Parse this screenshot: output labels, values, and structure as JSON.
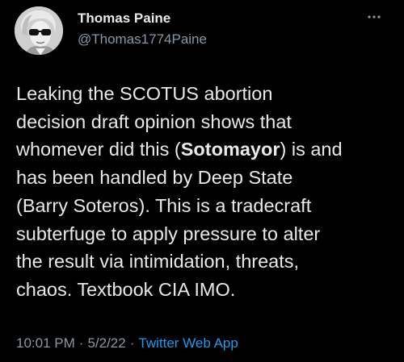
{
  "author": {
    "display_name": "Thomas Paine",
    "handle": "@Thomas1774Paine",
    "avatar_icon": "portrait-with-sunglasses-avatar"
  },
  "more_icon": "ellipsis-icon",
  "tweet": {
    "lines": [
      {
        "before": "Leaking the SCOTUS abortion",
        "bold": "",
        "after": ""
      },
      {
        "before": "decision draft opinion shows that",
        "bold": "",
        "after": ""
      },
      {
        "before": "whomever did this (",
        "bold": "Sotomayor",
        "after": ") is and"
      },
      {
        "before": "has been handled by Deep State",
        "bold": "",
        "after": ""
      },
      {
        "before": "(Barry Soteros). This is a tradecraft",
        "bold": "",
        "after": ""
      },
      {
        "before": "subterfuge to apply pressure to alter",
        "bold": "",
        "after": ""
      },
      {
        "before": "the result via intimidation, threats,",
        "bold": "",
        "after": ""
      },
      {
        "before": "chaos. Textbook CIA IMO.",
        "bold": "",
        "after": ""
      }
    ]
  },
  "meta": {
    "time": "10:01 PM",
    "separator": "·",
    "date": "5/2/22",
    "source": "Twitter Web App"
  },
  "colors": {
    "background": "#000000",
    "text": "#e7e9ea",
    "muted": "#8b98a5",
    "link": "#1d9bf0"
  }
}
